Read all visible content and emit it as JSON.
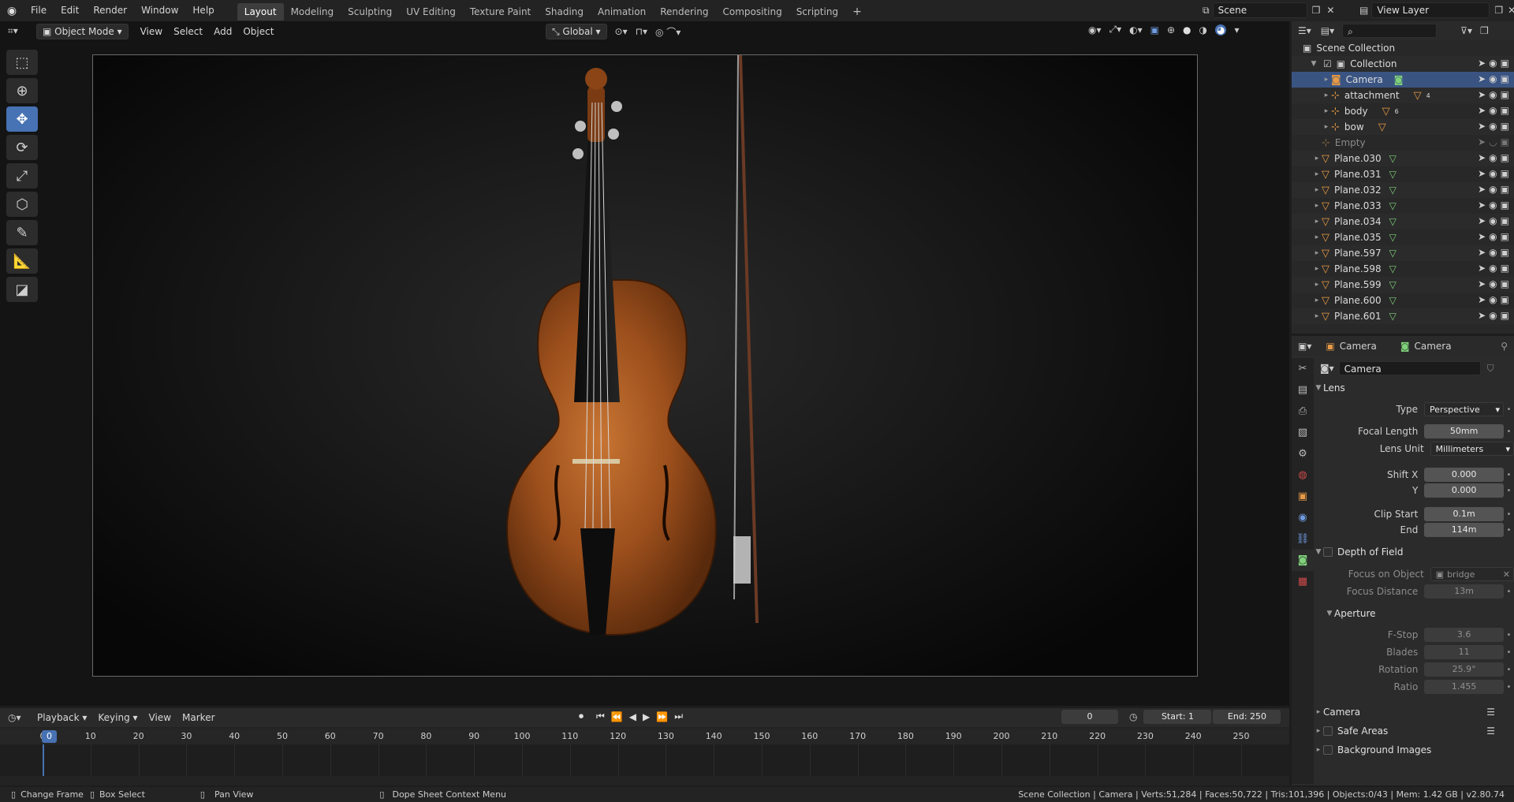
{
  "topbar": {
    "menus": [
      "File",
      "Edit",
      "Render",
      "Window",
      "Help"
    ],
    "workspaces": [
      "Layout",
      "Modeling",
      "Sculpting",
      "UV Editing",
      "Texture Paint",
      "Shading",
      "Animation",
      "Rendering",
      "Compositing",
      "Scripting"
    ],
    "active_workspace": "Layout",
    "scene": "Scene",
    "view_layer": "View Layer"
  },
  "viewport": {
    "mode": "Object Mode",
    "menus": [
      "View",
      "Select",
      "Add",
      "Object"
    ],
    "transform_orientation": "Global",
    "tools": [
      "select-box-icon",
      "cursor-icon",
      "move-icon",
      "rotate-icon",
      "scale-icon",
      "transform-icon",
      "annotate-icon",
      "measure-icon",
      "add-cube-icon"
    ],
    "active_tool": "move-icon"
  },
  "outliner": {
    "search_placeholder": "",
    "root": "Scene Collection",
    "collection": "Collection",
    "items": [
      {
        "name": "Camera",
        "selected": true
      },
      {
        "name": "attachment",
        "badge": "4"
      },
      {
        "name": "body",
        "badge": "6"
      },
      {
        "name": "bow"
      },
      {
        "name": "Empty",
        "dim": true
      },
      {
        "name": "Plane.030"
      },
      {
        "name": "Plane.031"
      },
      {
        "name": "Plane.032"
      },
      {
        "name": "Plane.033"
      },
      {
        "name": "Plane.034"
      },
      {
        "name": "Plane.035"
      },
      {
        "name": "Plane.597"
      },
      {
        "name": "Plane.598"
      },
      {
        "name": "Plane.599"
      },
      {
        "name": "Plane.600"
      },
      {
        "name": "Plane.601"
      }
    ]
  },
  "properties": {
    "breadcrumb_object": "Camera",
    "breadcrumb_data": "Camera",
    "datablock": "Camera",
    "lens_section": "Lens",
    "type_label": "Type",
    "type_value": "Perspective",
    "focal_length_label": "Focal Length",
    "focal_length": "50mm",
    "lens_unit_label": "Lens Unit",
    "lens_unit": "Millimeters",
    "shift_x_label": "Shift X",
    "shift_x": "0.000",
    "shift_y_label": "Y",
    "shift_y": "0.000",
    "clip_start_label": "Clip Start",
    "clip_start": "0.1m",
    "clip_end_label": "End",
    "clip_end": "114m",
    "dof_section": "Depth of Field",
    "focus_object_label": "Focus on Object",
    "focus_object": "bridge",
    "focus_distance_label": "Focus Distance",
    "focus_distance": "13m",
    "aperture_section": "Aperture",
    "fstop_label": "F-Stop",
    "fstop": "3.6",
    "blades_label": "Blades",
    "blades": "11",
    "rotation_label": "Rotation",
    "rotation": "25.9°",
    "ratio_label": "Ratio",
    "ratio": "1.455",
    "camera_section": "Camera",
    "safe_areas_section": "Safe Areas",
    "bg_images_section": "Background Images"
  },
  "timeline": {
    "menus": [
      "Playback",
      "Keying",
      "View",
      "Marker"
    ],
    "current_frame": "0",
    "start_label": "Start:",
    "start": "1",
    "end_label": "End:",
    "end": "250",
    "ticks": [
      "0",
      "10",
      "20",
      "30",
      "40",
      "50",
      "60",
      "70",
      "80",
      "90",
      "100",
      "110",
      "120",
      "130",
      "140",
      "150",
      "160",
      "170",
      "180",
      "190",
      "200",
      "210",
      "220",
      "230",
      "240",
      "250"
    ]
  },
  "statusbar": {
    "hint1": "Change Frame",
    "hint2": "Box Select",
    "hint3": "Pan View",
    "hint4": "Dope Sheet Context Menu",
    "stats": "Scene Collection | Camera | Verts:51,284 | Faces:50,722 | Tris:101,396 | Objects:0/43 | Mem: 1.42 GB | v2.80.74"
  },
  "colors": {
    "accent": "#4772b3",
    "object_icon": "#e79a45",
    "mesh_icon": "#7fd07a"
  }
}
